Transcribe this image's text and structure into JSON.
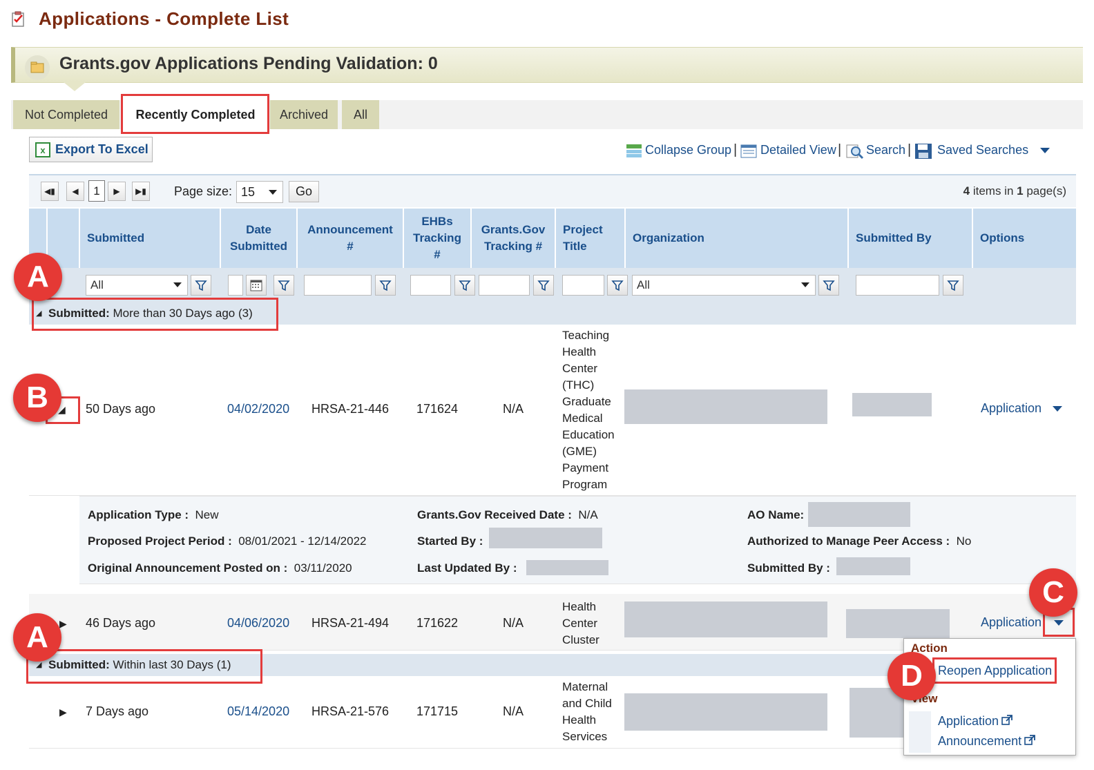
{
  "page": {
    "title": "Applications - Complete List",
    "pending_text": "Grants.gov Applications Pending Validation: 0"
  },
  "tabs": [
    "Not Completed",
    "Recently Completed",
    "Archived",
    "All"
  ],
  "toolbar": {
    "export_label": "Export To Excel",
    "collapse_label": "Collapse Group",
    "detailed_label": "Detailed View",
    "search_label": "Search",
    "saved_label": "Saved Searches"
  },
  "pager": {
    "current_page": "1",
    "page_size_label": "Page size:",
    "page_size_value": "15",
    "go_label": "Go",
    "items_count": "4",
    "pages_count": "1",
    "items_text_a": " items in ",
    "items_text_b": " page(s)"
  },
  "columns": {
    "submitted": "Submitted",
    "date_submitted": "Date Submitted",
    "announcement": "Announcement #",
    "ehbs": "EHBs Tracking #",
    "grants_gov": "Grants.Gov Tracking #",
    "project_title": "Project Title",
    "organization": "Organization",
    "submitted_by": "Submitted By",
    "options": "Options"
  },
  "filters": {
    "submitted_value": "All",
    "organization_value": "All"
  },
  "groups": [
    {
      "label": "Submitted:",
      "value": "More than 30 Days ago (3)"
    },
    {
      "label": "Submitted:",
      "value": "Within last 30 Days (1)"
    }
  ],
  "rows": [
    {
      "submitted": "50 Days ago",
      "date": "04/02/2020",
      "announcement": "HRSA-21-446",
      "ehbs": "171624",
      "grants": "N/A",
      "title": "Teaching Health Center (THC) Graduate Medical Education (GME) Payment Program",
      "option": "Application"
    },
    {
      "submitted": "46 Days ago",
      "date": "04/06/2020",
      "announcement": "HRSA-21-494",
      "ehbs": "171622",
      "grants": "N/A",
      "title": "Health Center Cluster",
      "option": "Application"
    },
    {
      "submitted": "7 Days ago",
      "date": "05/14/2020",
      "announcement": "HRSA-21-576",
      "ehbs": "171715",
      "grants": "N/A",
      "title": "Maternal and Child Health Services",
      "option": "Application"
    }
  ],
  "detail": {
    "app_type_label": "Application Type :",
    "app_type_value": "New",
    "period_label": "Proposed Project Period :",
    "period_value": "08/01/2021 - 12/14/2022",
    "orig_label": "Original Announcement Posted on :",
    "orig_value": "03/11/2020",
    "received_label": "Grants.Gov Received Date :",
    "received_value": "N/A",
    "started_label": "Started By :",
    "updated_label": "Last Updated By :",
    "ao_label": "AO Name:",
    "peer_label": "Authorized to Manage Peer Access :",
    "peer_value": "No",
    "subby_label": "Submitted By :"
  },
  "menu": {
    "action_header": "Action",
    "reopen": "Reopen Appplication",
    "view_header": "View",
    "view_application": "Application",
    "view_announcement": "Announcement"
  },
  "callouts": [
    "A",
    "B",
    "A",
    "C",
    "D"
  ],
  "colors": {
    "title": "#7b2a10",
    "link": "#1a4f8b",
    "callout": "#e53935",
    "header_bg": "#c8dcef"
  }
}
